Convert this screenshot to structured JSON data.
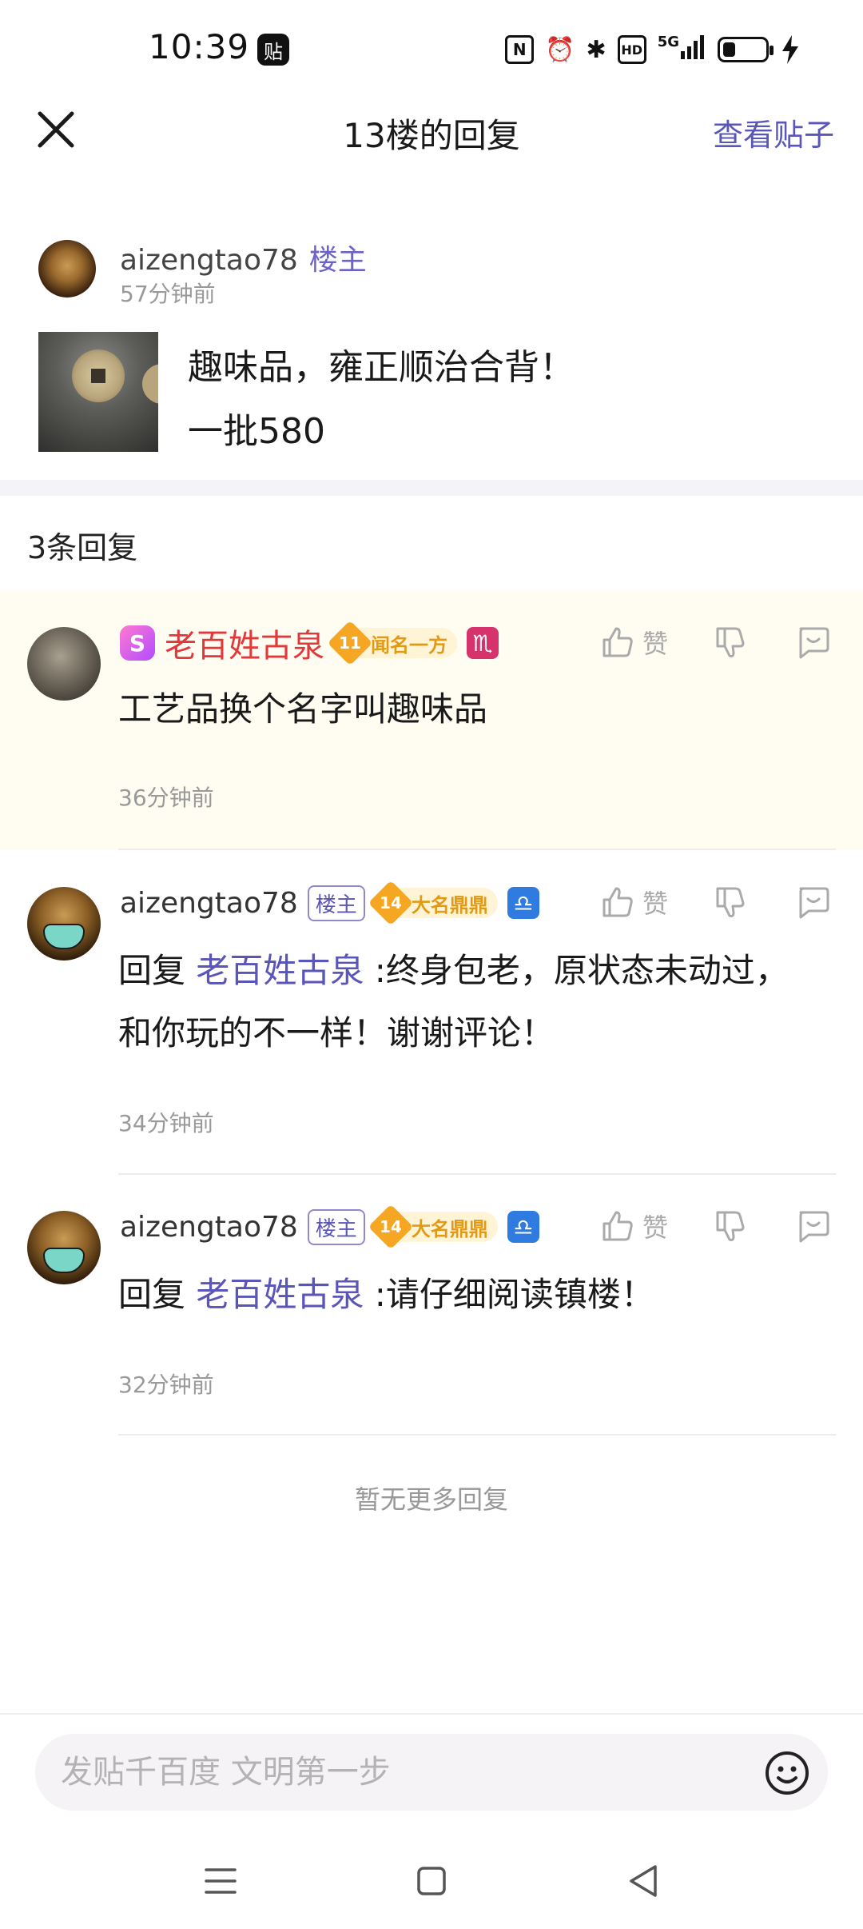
{
  "status_bar": {
    "time": "10:39",
    "app_badge": "贴",
    "nfc": "N",
    "alarm": "⏰",
    "bluetooth": "✱",
    "hd": "HD",
    "network": "5G",
    "battery_level": 0.3
  },
  "header": {
    "title": "13楼的回复",
    "view_post": "查看贴子"
  },
  "main_post": {
    "author": "aizengtao78",
    "author_tag": "楼主",
    "time": "57分钟前",
    "lines": [
      "趣味品，雍正顺治合背！",
      "一批580"
    ]
  },
  "reply_count": "3条回复",
  "like_label": "赞",
  "replies": [
    {
      "author": "老百姓古泉",
      "vip_badge": "S",
      "level": "11",
      "level_title": "闻名一方",
      "zodiac": "♏",
      "content": "工艺品换个名字叫趣味品",
      "time": "36分钟前"
    },
    {
      "author": "aizengtao78",
      "author_tag": "楼主",
      "level": "14",
      "level_title": "大名鼎鼎",
      "zodiac": "♎",
      "reply_prefix": "回复",
      "mention": "老百姓古泉",
      "content": " :终身包老，原状态未动过，和你玩的不一样！谢谢评论！",
      "time": "34分钟前"
    },
    {
      "author": "aizengtao78",
      "author_tag": "楼主",
      "level": "14",
      "level_title": "大名鼎鼎",
      "zodiac": "♎",
      "reply_prefix": "回复",
      "mention": "老百姓古泉",
      "content": " :请仔细阅读镇楼！",
      "time": "32分钟前"
    }
  ],
  "no_more": "暂无更多回复",
  "compose": {
    "placeholder": "发贴千百度 文明第一步"
  },
  "colors": {
    "accent": "#5a55b8",
    "red_name": "#e0383b",
    "highlight_bg": "#fffdf1"
  }
}
